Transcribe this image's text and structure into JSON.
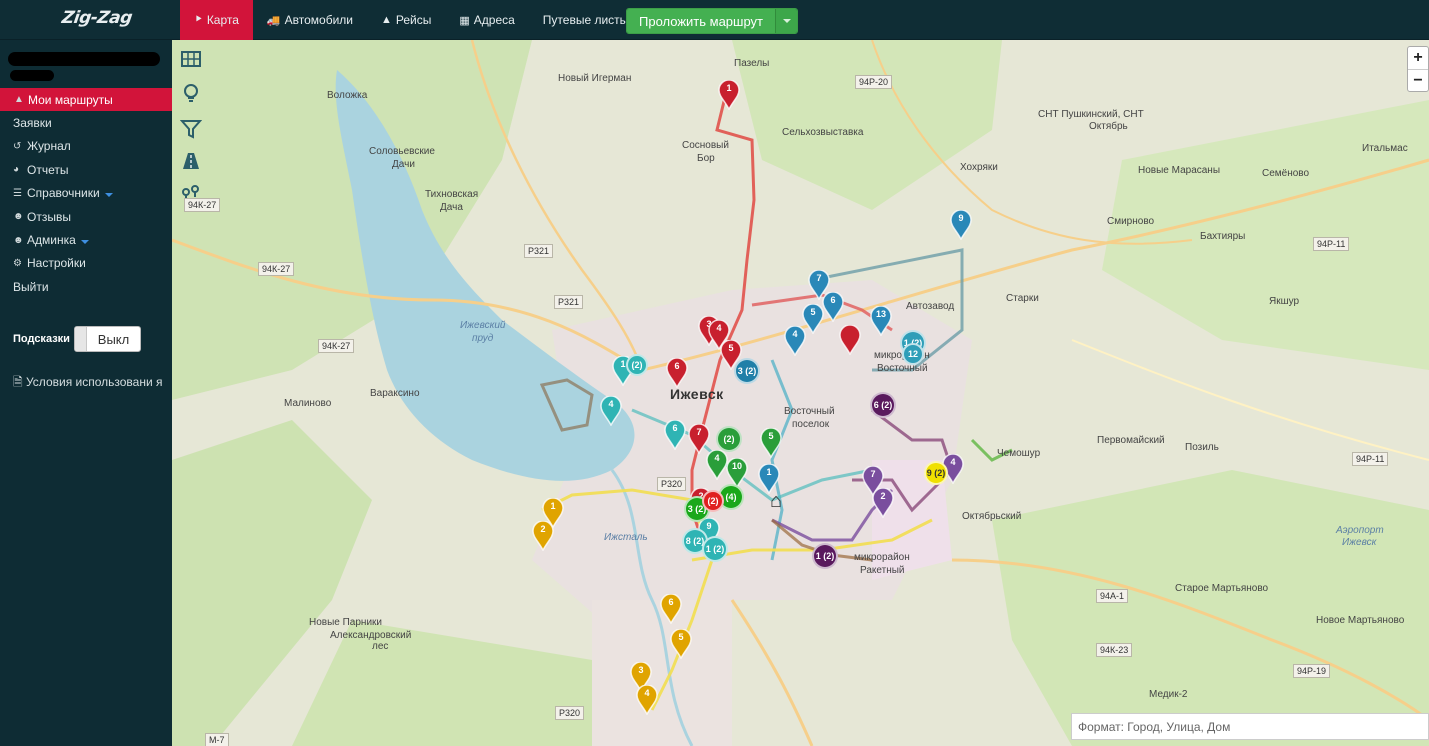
{
  "app": {
    "logo": "Zig-Zag"
  },
  "nav": [
    {
      "icon": "map-pin-icon",
      "label": "Карта",
      "active": true
    },
    {
      "icon": "truck-icon",
      "label": "Автомобили"
    },
    {
      "icon": "road-icon",
      "label": "Рейсы"
    },
    {
      "icon": "building-icon",
      "label": "Адреса"
    },
    {
      "label": "Путевые листы",
      "dropdown": true
    }
  ],
  "route_button": {
    "label": "Проложить маршрут"
  },
  "sidebar": {
    "menu": [
      {
        "icon": "road-icon",
        "label": "Мои маршруты",
        "active": true
      },
      {
        "label": "Заявки"
      },
      {
        "icon": "history-icon",
        "label": "Журнал"
      },
      {
        "icon": "pie-chart-icon",
        "label": "Отчеты"
      },
      {
        "icon": "list-icon",
        "label": "Справочники",
        "dropdown": true
      },
      {
        "icon": "users-icon",
        "label": "Отзывы"
      },
      {
        "icon": "users-icon",
        "label": "Админка",
        "dropdown": true
      },
      {
        "icon": "gear-icon",
        "label": "Настройки"
      },
      {
        "label": "Выйти"
      }
    ],
    "hints": {
      "label": "Подсказки",
      "toggle": "Выкл"
    },
    "terms": "Условия использовани я"
  },
  "map": {
    "zoom_in": "+",
    "zoom_out": "−",
    "search_placeholder": "Формат: Город, Улица, Дом",
    "places": [
      "Пазелы",
      "Новый Игерман",
      "Воложка",
      "Сельхозвыставка",
      "Сосновый",
      "Бор",
      "Соловьевские",
      "Дачи",
      "Тихновская",
      "Дача",
      "Хохряки",
      "Новые Марасаны",
      "Семёново",
      "Смирново",
      "Бахтияры",
      "Итальмас",
      "Старки",
      "Якшур",
      "Ижевский",
      "пруд",
      "Ижевск",
      "Малиново",
      "Вараксино",
      "Восточный",
      "поселок",
      "микрорайон",
      "Восточный",
      "Первомайский",
      "Чемошур",
      "Позиль",
      "Октябрьский",
      "Ижсталь",
      "микрорайон",
      "Ракетный",
      "Новые Парники",
      "Александровский",
      "лес",
      "Старое Мартьяново",
      "Новое Мартьяново",
      "Медик-2",
      "Аэропорт",
      "Ижевск",
      "Автозавод",
      "СНТ Пушкинский, СНТ",
      "Октябрь"
    ],
    "roads": [
      "94Р-20",
      "94К-27",
      "94К-27",
      "94К-27",
      "Р321",
      "Р321",
      "94Р-11",
      "94Р-11",
      "Р320",
      "94А-1",
      "94К-23",
      "94Р-19",
      "Р320",
      "М-7"
    ],
    "markers": [
      {
        "label": "1",
        "color": "#c8202e"
      },
      {
        "label": "3",
        "color": "#c8202e"
      },
      {
        "label": "4",
        "color": "#c8202e"
      },
      {
        "label": "5",
        "color": "#c8202e"
      },
      {
        "label": "6",
        "color": "#c8202e"
      },
      {
        "label": "7",
        "color": "#c8202e"
      },
      {
        "label": "2",
        "color": "#c8202e"
      },
      {
        "label": "7",
        "color": "#2a88b8"
      },
      {
        "label": "6",
        "color": "#2a88b8"
      },
      {
        "label": "5",
        "color": "#2a88b8"
      },
      {
        "label": "4",
        "color": "#2a88b8"
      },
      {
        "label": "13",
        "color": "#2a88b8"
      },
      {
        "label": "9",
        "color": "#2a88b8"
      },
      {
        "label": "1",
        "color": "#2a88b8"
      },
      {
        "label": "1",
        "color": "#2fb4b4"
      },
      {
        "label": "4",
        "color": "#2fb4b4"
      },
      {
        "label": "6",
        "color": "#2fb4b4"
      },
      {
        "label": "9",
        "color": "#2fb4b4"
      },
      {
        "label": "4",
        "color": "#2a9e3a"
      },
      {
        "label": "5",
        "color": "#2a9e3a"
      },
      {
        "label": "10",
        "color": "#2a9e3a"
      },
      {
        "label": "7",
        "color": "#7a4e9e"
      },
      {
        "label": "2",
        "color": "#7a4e9e"
      },
      {
        "label": "4",
        "color": "#7a4e9e"
      },
      {
        "label": "1",
        "color": "#e0a400"
      },
      {
        "label": "2",
        "color": "#e0a400"
      },
      {
        "label": "6",
        "color": "#e0a400"
      },
      {
        "label": "5",
        "color": "#e0a400"
      },
      {
        "label": "3",
        "color": "#e0a400"
      },
      {
        "label": "4",
        "color": "#e0a400"
      },
      {
        "label": "",
        "color": "#c8202e"
      }
    ],
    "clusters": [
      {
        "label": "3 (2)",
        "color": "#1f7fa8"
      },
      {
        "label": "1 (2)",
        "color": "#2f9eb8"
      },
      {
        "label": "12",
        "color": "#2f9eb8"
      },
      {
        "label": "(2)",
        "color": "#2fb4b4"
      },
      {
        "label": "(2)",
        "color": "#2a9e3a"
      },
      {
        "label": "(4)",
        "color": "#1aa81a"
      },
      {
        "label": "3 (2)",
        "color": "#1aa81a"
      },
      {
        "label": "(2)",
        "color": "#e02020"
      },
      {
        "label": "8 (2)",
        "color": "#2fb4b4"
      },
      {
        "label": "1 (2)",
        "color": "#2fb4b4"
      },
      {
        "label": "6 (2)",
        "color": "#5a1a5e"
      },
      {
        "label": "1 (2)",
        "color": "#5a1a5e"
      },
      {
        "label": "9 (2)",
        "color": "#f0e000"
      }
    ]
  }
}
